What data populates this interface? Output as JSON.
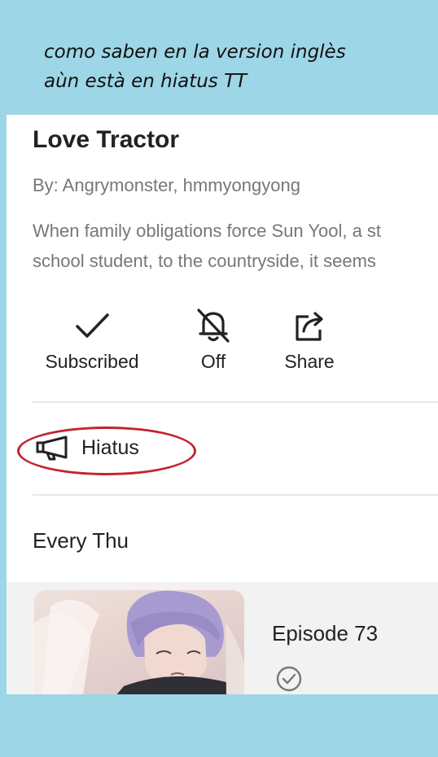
{
  "caption": "como saben en la version inglès\naùn està en hiatus TT",
  "series": {
    "title": "Love Tractor",
    "authors": "By: Angrymonster, hmmyongyong",
    "description_lines": [
      "When family obligations force Sun Yool, a st",
      "school student, to the countryside, it seems"
    ]
  },
  "actions": [
    {
      "label": "Subscribed",
      "icon": "checkmark-icon"
    },
    {
      "label": "Off",
      "icon": "notification-off-icon"
    },
    {
      "label": "Share",
      "icon": "share-icon"
    }
  ],
  "status": {
    "label": "Hiatus",
    "icon": "megaphone-icon",
    "highlight_color": "#c3242f"
  },
  "schedule": "Every Thu",
  "episode": {
    "title": "Episode 73",
    "status_icon": "check-circle-icon"
  },
  "colors": {
    "background": "#9dd6e6",
    "card": "#ffffff",
    "text": "#222222",
    "muted": "#777777"
  }
}
